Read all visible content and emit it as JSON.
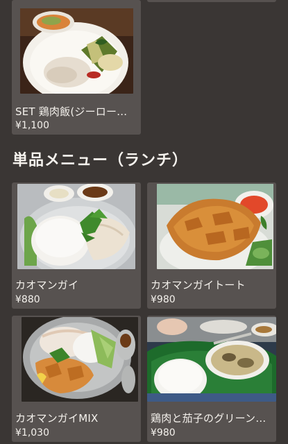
{
  "section": {
    "title": "単品メニュー（ランチ）"
  },
  "items": [
    {
      "name": "SET 鶏肉飯(ジーロー…",
      "price": "¥1,100",
      "image": "set-chicken-rice-plate"
    },
    {
      "name": "カオマンガイ",
      "price": "¥880",
      "image": "khao-man-gai-plate"
    },
    {
      "name": "カオマンガイトート",
      "price": "¥980",
      "image": "fried-chicken-rice-plate"
    },
    {
      "name": "カオマンガイMIX",
      "price": "¥1,030",
      "image": "mixed-chicken-rice-plate"
    },
    {
      "name": "鶏肉と茄子のグリーン…",
      "price": "¥980",
      "image": "green-curry-set"
    }
  ]
}
